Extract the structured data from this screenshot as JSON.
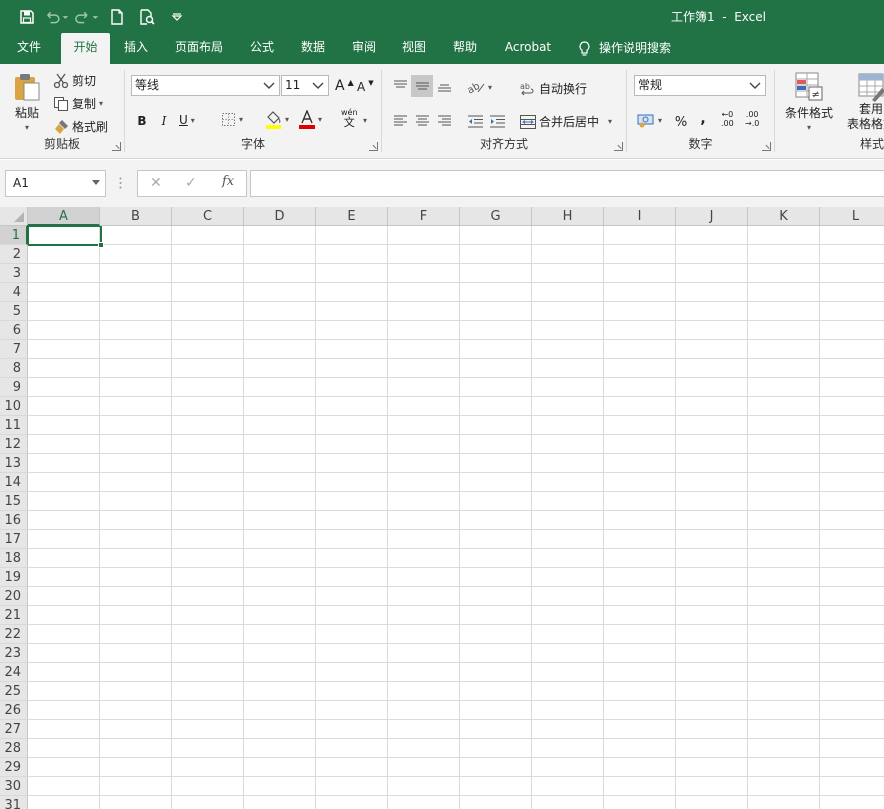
{
  "window": {
    "title": "工作簿1  -  Excel"
  },
  "tabs": [
    {
      "label": "文件",
      "active": false
    },
    {
      "label": "开始",
      "active": true
    },
    {
      "label": "插入",
      "active": false
    },
    {
      "label": "页面布局",
      "active": false
    },
    {
      "label": "公式",
      "active": false
    },
    {
      "label": "数据",
      "active": false
    },
    {
      "label": "审阅",
      "active": false
    },
    {
      "label": "视图",
      "active": false
    },
    {
      "label": "帮助",
      "active": false
    },
    {
      "label": "Acrobat",
      "active": false
    }
  ],
  "search": {
    "label": "操作说明搜索",
    "icon": "lightbulb-icon"
  },
  "clipboard": {
    "group_label": "剪贴板",
    "paste": "粘贴",
    "cut": "剪切",
    "copy": "复制",
    "format_painter": "格式刷"
  },
  "font": {
    "group_label": "字体",
    "font_name": "等线",
    "font_size": "11",
    "bold": "B",
    "italic": "I",
    "underline": "U",
    "increase_size": "A",
    "decrease_size": "A",
    "phonetic_top": "wén",
    "phonetic_bottom": "文",
    "colors": {
      "highlight": "#ffff00",
      "font": "#e00000"
    }
  },
  "alignment": {
    "group_label": "对齐方式",
    "wrap_text": "自动换行",
    "merge_center": "合并后居中"
  },
  "number": {
    "group_label": "数字",
    "format": "常规",
    "percent": "%",
    "comma": ",",
    "inc_decimal_top": "←0",
    "inc_decimal_bottom": ".00",
    "dec_decimal_top": ".00",
    "dec_decimal_bottom": "→.0"
  },
  "styles": {
    "group_label": "样式",
    "conditional": "条件格式",
    "table_line1": "套用",
    "table_line2": "表格格式"
  },
  "formula_bar": {
    "name_box": "A1",
    "fx": "fx",
    "cancel": "✕",
    "enter": "✓",
    "value": ""
  },
  "columns": [
    "A",
    "B",
    "C",
    "D",
    "E",
    "F",
    "G",
    "H",
    "I",
    "J",
    "K",
    "L"
  ],
  "rows": [
    "1",
    "2",
    "3",
    "4",
    "5",
    "6",
    "7",
    "8",
    "9",
    "10",
    "11",
    "12",
    "13",
    "14",
    "15",
    "16",
    "17",
    "18",
    "19",
    "20",
    "21",
    "22",
    "23",
    "24",
    "25",
    "26",
    "27",
    "28",
    "29",
    "30",
    "31"
  ],
  "selection": {
    "column": "A",
    "row": "1"
  },
  "colors": {
    "accent": "#217346"
  }
}
